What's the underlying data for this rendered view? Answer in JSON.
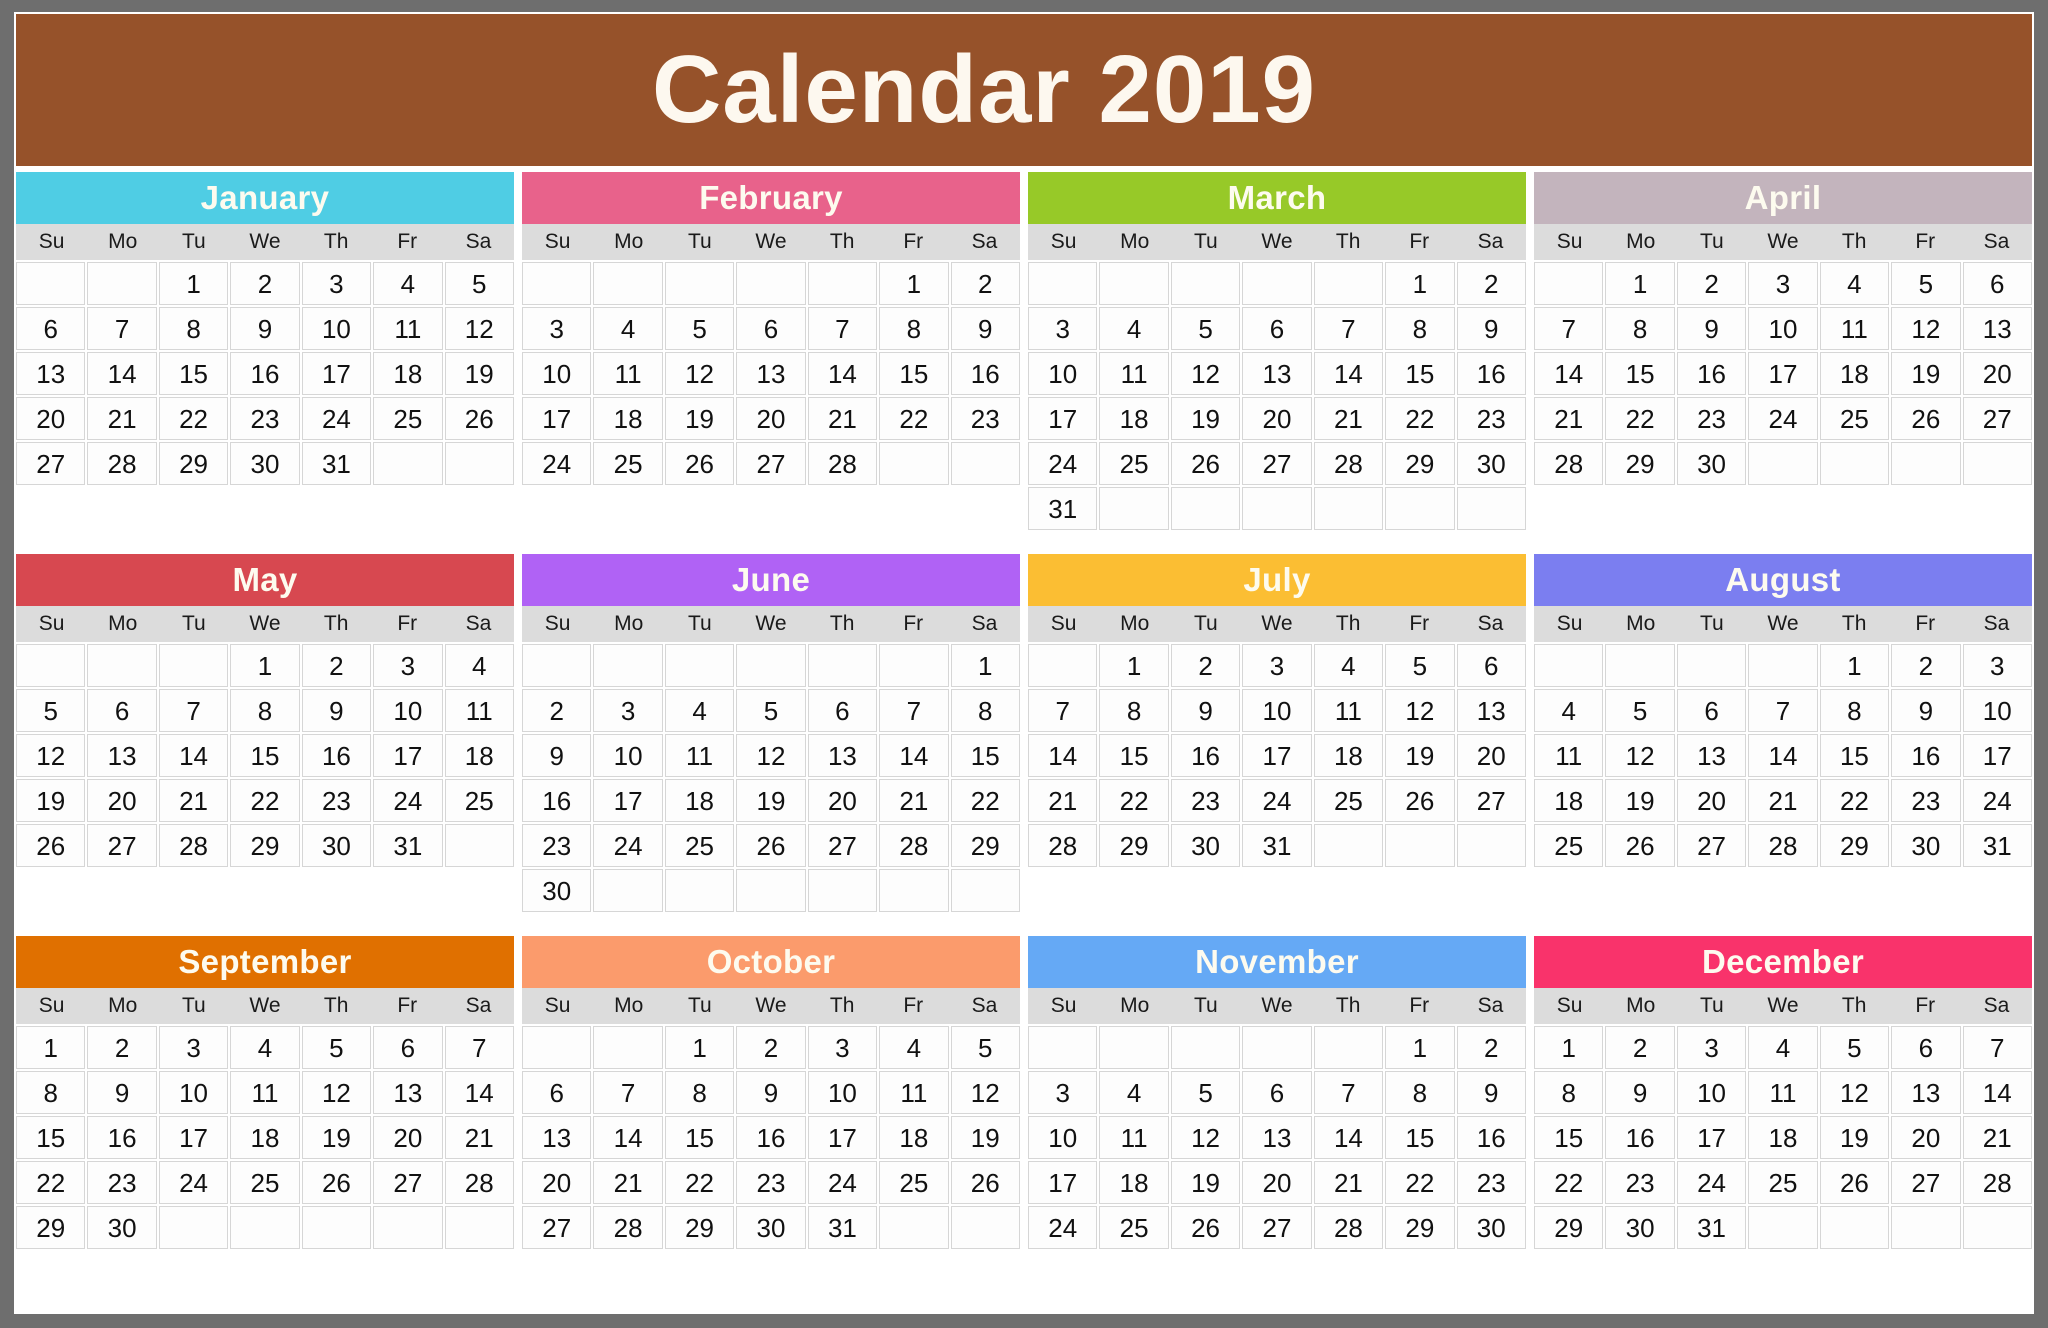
{
  "title": "Calendar 2019",
  "colors": {
    "page_background": "#6e6e6e",
    "sheet_background": "#ffffff",
    "title_banner": "#96522a",
    "title_text": "#fdf8ef",
    "weekday_row": "#dcdcdc",
    "day_text": "#111111",
    "cell_border": "#d6d6d6"
  },
  "weekdays": [
    "Su",
    "Mo",
    "Tu",
    "We",
    "Th",
    "Fr",
    "Sa"
  ],
  "months": [
    {
      "name": "January",
      "header_color": "#4fcde4",
      "weeks": [
        [
          "",
          "",
          "1",
          "2",
          "3",
          "4",
          "5"
        ],
        [
          "6",
          "7",
          "8",
          "9",
          "10",
          "11",
          "12"
        ],
        [
          "13",
          "14",
          "15",
          "16",
          "17",
          "18",
          "19"
        ],
        [
          "20",
          "21",
          "22",
          "23",
          "24",
          "25",
          "26"
        ],
        [
          "27",
          "28",
          "29",
          "30",
          "31",
          "",
          ""
        ]
      ]
    },
    {
      "name": "February",
      "header_color": "#e8628b",
      "weeks": [
        [
          "",
          "",
          "",
          "",
          "",
          "1",
          "2"
        ],
        [
          "3",
          "4",
          "5",
          "6",
          "7",
          "8",
          "9"
        ],
        [
          "10",
          "11",
          "12",
          "13",
          "14",
          "15",
          "16"
        ],
        [
          "17",
          "18",
          "19",
          "20",
          "21",
          "22",
          "23"
        ],
        [
          "24",
          "25",
          "26",
          "27",
          "28",
          "",
          ""
        ]
      ]
    },
    {
      "name": "March",
      "header_color": "#97c928",
      "weeks": [
        [
          "",
          "",
          "",
          "",
          "",
          "1",
          "2"
        ],
        [
          "3",
          "4",
          "5",
          "6",
          "7",
          "8",
          "9"
        ],
        [
          "10",
          "11",
          "12",
          "13",
          "14",
          "15",
          "16"
        ],
        [
          "17",
          "18",
          "19",
          "20",
          "21",
          "22",
          "23"
        ],
        [
          "24",
          "25",
          "26",
          "27",
          "28",
          "29",
          "30"
        ],
        [
          "31",
          "",
          "",
          "",
          "",
          "",
          ""
        ]
      ]
    },
    {
      "name": "April",
      "header_color": "#c3b4bd",
      "weeks": [
        [
          "",
          "1",
          "2",
          "3",
          "4",
          "5",
          "6"
        ],
        [
          "7",
          "8",
          "9",
          "10",
          "11",
          "12",
          "13"
        ],
        [
          "14",
          "15",
          "16",
          "17",
          "18",
          "19",
          "20"
        ],
        [
          "21",
          "22",
          "23",
          "24",
          "25",
          "26",
          "27"
        ],
        [
          "28",
          "29",
          "30",
          "",
          "",
          "",
          ""
        ]
      ]
    },
    {
      "name": "May",
      "header_color": "#d74850",
      "weeks": [
        [
          "",
          "",
          "",
          "1",
          "2",
          "3",
          "4"
        ],
        [
          "5",
          "6",
          "7",
          "8",
          "9",
          "10",
          "11"
        ],
        [
          "12",
          "13",
          "14",
          "15",
          "16",
          "17",
          "18"
        ],
        [
          "19",
          "20",
          "21",
          "22",
          "23",
          "24",
          "25"
        ],
        [
          "26",
          "27",
          "28",
          "29",
          "30",
          "31",
          ""
        ]
      ]
    },
    {
      "name": "June",
      "header_color": "#b062f5",
      "weeks": [
        [
          "",
          "",
          "",
          "",
          "",
          "",
          "1"
        ],
        [
          "2",
          "3",
          "4",
          "5",
          "6",
          "7",
          "8"
        ],
        [
          "9",
          "10",
          "11",
          "12",
          "13",
          "14",
          "15"
        ],
        [
          "16",
          "17",
          "18",
          "19",
          "20",
          "21",
          "22"
        ],
        [
          "23",
          "24",
          "25",
          "26",
          "27",
          "28",
          "29"
        ],
        [
          "30",
          "",
          "",
          "",
          "",
          "",
          ""
        ]
      ]
    },
    {
      "name": "July",
      "header_color": "#fbbe33",
      "weeks": [
        [
          "",
          "1",
          "2",
          "3",
          "4",
          "5",
          "6"
        ],
        [
          "7",
          "8",
          "9",
          "10",
          "11",
          "12",
          "13"
        ],
        [
          "14",
          "15",
          "16",
          "17",
          "18",
          "19",
          "20"
        ],
        [
          "21",
          "22",
          "23",
          "24",
          "25",
          "26",
          "27"
        ],
        [
          "28",
          "29",
          "30",
          "31",
          "",
          "",
          ""
        ]
      ]
    },
    {
      "name": "August",
      "header_color": "#7b7ef0",
      "weeks": [
        [
          "",
          "",
          "",
          "",
          "1",
          "2",
          "3"
        ],
        [
          "4",
          "5",
          "6",
          "7",
          "8",
          "9",
          "10"
        ],
        [
          "11",
          "12",
          "13",
          "14",
          "15",
          "16",
          "17"
        ],
        [
          "18",
          "19",
          "20",
          "21",
          "22",
          "23",
          "24"
        ],
        [
          "25",
          "26",
          "27",
          "28",
          "29",
          "30",
          "31"
        ]
      ]
    },
    {
      "name": "September",
      "header_color": "#e07000",
      "weeks": [
        [
          "1",
          "2",
          "3",
          "4",
          "5",
          "6",
          "7"
        ],
        [
          "8",
          "9",
          "10",
          "11",
          "12",
          "13",
          "14"
        ],
        [
          "15",
          "16",
          "17",
          "18",
          "19",
          "20",
          "21"
        ],
        [
          "22",
          "23",
          "24",
          "25",
          "26",
          "27",
          "28"
        ],
        [
          "29",
          "30",
          "",
          "",
          "",
          "",
          ""
        ]
      ]
    },
    {
      "name": "October",
      "header_color": "#fb9b6c",
      "weeks": [
        [
          "",
          "",
          "1",
          "2",
          "3",
          "4",
          "5"
        ],
        [
          "6",
          "7",
          "8",
          "9",
          "10",
          "11",
          "12"
        ],
        [
          "13",
          "14",
          "15",
          "16",
          "17",
          "18",
          "19"
        ],
        [
          "20",
          "21",
          "22",
          "23",
          "24",
          "25",
          "26"
        ],
        [
          "27",
          "28",
          "29",
          "30",
          "31",
          "",
          ""
        ]
      ]
    },
    {
      "name": "November",
      "header_color": "#65a9f5",
      "weeks": [
        [
          "",
          "",
          "",
          "",
          "",
          "1",
          "2"
        ],
        [
          "3",
          "4",
          "5",
          "6",
          "7",
          "8",
          "9"
        ],
        [
          "10",
          "11",
          "12",
          "13",
          "14",
          "15",
          "16"
        ],
        [
          "17",
          "18",
          "19",
          "20",
          "21",
          "22",
          "23"
        ],
        [
          "24",
          "25",
          "26",
          "27",
          "28",
          "29",
          "30"
        ]
      ]
    },
    {
      "name": "December",
      "header_color": "#f9336b",
      "weeks": [
        [
          "1",
          "2",
          "3",
          "4",
          "5",
          "6",
          "7"
        ],
        [
          "8",
          "9",
          "10",
          "11",
          "12",
          "13",
          "14"
        ],
        [
          "15",
          "16",
          "17",
          "18",
          "19",
          "20",
          "21"
        ],
        [
          "22",
          "23",
          "24",
          "25",
          "26",
          "27",
          "28"
        ],
        [
          "29",
          "30",
          "31",
          "",
          "",
          "",
          ""
        ]
      ]
    }
  ]
}
